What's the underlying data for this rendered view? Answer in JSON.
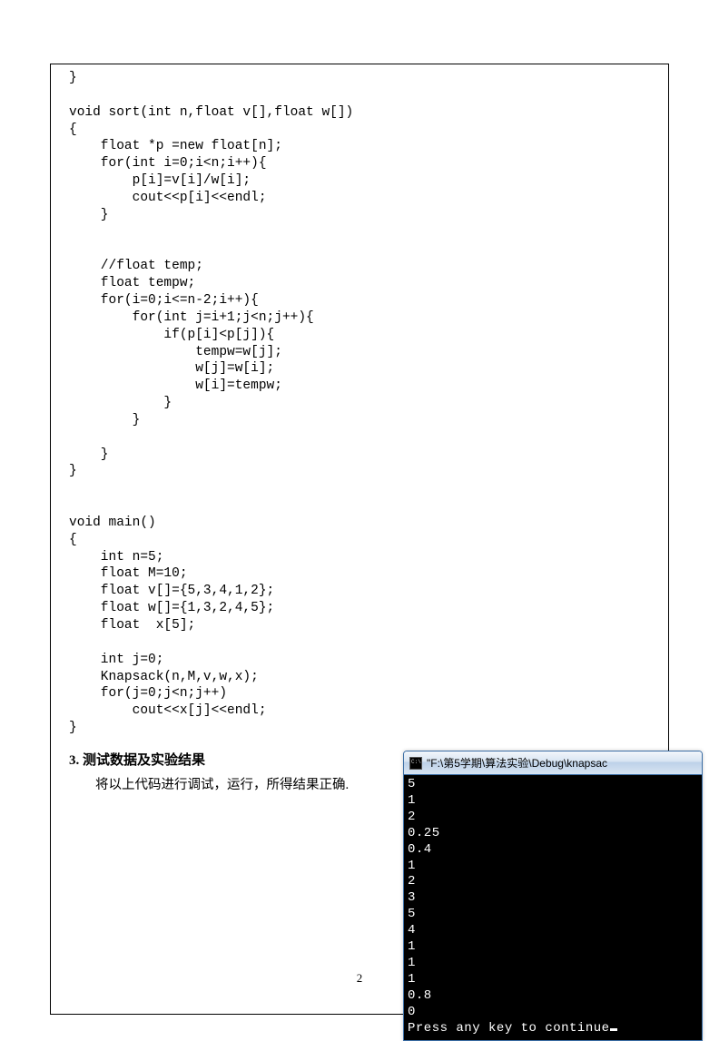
{
  "code": "}\n\nvoid sort(int n,float v[],float w[])\n{\n    float *p =new float[n];\n    for(int i=0;i<n;i++){\n        p[i]=v[i]/w[i];\n        cout<<p[i]<<endl;\n    }\n\n\n    //float temp;\n    float tempw;\n    for(i=0;i<=n-2;i++){\n        for(int j=i+1;j<n;j++){\n            if(p[i]<p[j]){\n                tempw=w[j];\n                w[j]=w[i];\n                w[i]=tempw;\n            }\n        }\n\n    }\n}\n\n\nvoid main()\n{\n    int n=5;\n    float M=10;\n    float v[]={5,3,4,1,2};\n    float w[]={1,3,2,4,5};\n    float  x[5];\n\n    int j=0;\n    Knapsack(n,M,v,w,x);\n    for(j=0;j<n;j++)\n        cout<<x[j]<<endl;\n}",
  "section": {
    "heading": "3. 测试数据及实验结果",
    "body": "将以上代码进行调试，运行，所得结果正确."
  },
  "console": {
    "title": "\"F:\\第5学期\\算法实验\\Debug\\knapsac",
    "output": "5\n1\n2\n0.25\n0.4\n1\n2\n3\n5\n4\n1\n1\n1\n0.8\n0\nPress any key to continue"
  },
  "pageNumber": "2"
}
